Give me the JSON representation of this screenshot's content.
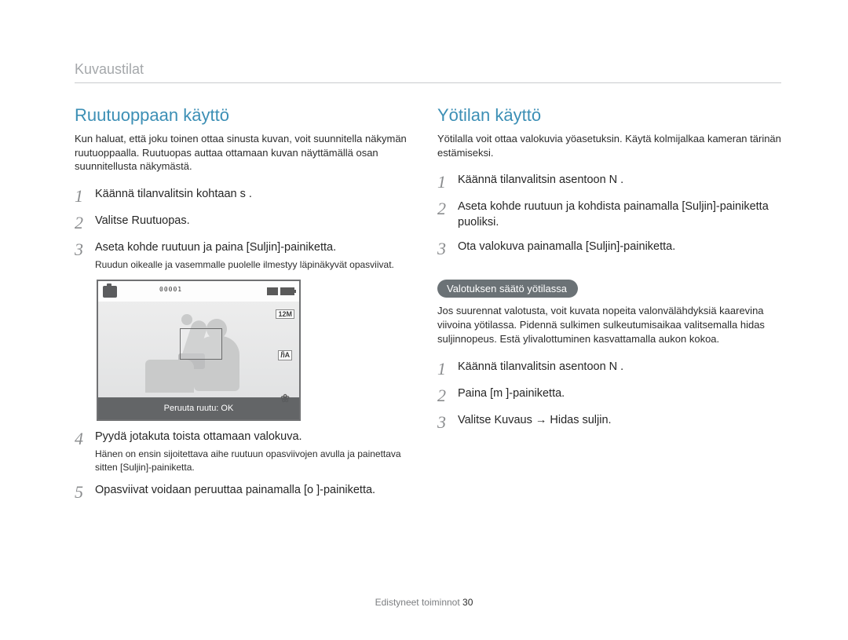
{
  "header": {
    "section": "Kuvaustilat"
  },
  "left": {
    "title": "Ruutuoppaan käyttö",
    "intro": "Kun haluat, että joku toinen ottaa sinusta kuvan, voit suunnitella näkymän ruutuoppaalla. Ruutuopas auttaa ottamaan kuvan näyttämällä osan suunnitellusta näkymästä.",
    "steps": {
      "1": "Käännä tilanvalitsin kohtaan  s     .",
      "2": "Valitse Ruutuopas.",
      "3": "Aseta kohde ruutuun ja paina [Suljin]-painiketta.",
      "3_sub": "Ruudun oikealle ja vasemmalle puolelle ilmestyy läpinäkyvät opasviivat.",
      "4": "Pyydä jotakuta toista ottamaan valokuva.",
      "4_sub": "Hänen on ensin sijoitettava aihe ruutuun opasviivojen avulla ja painettava sitten [Suljin]-painiketta.",
      "5": "Opasviivat voidaan peruuttaa painamalla [o    ]-painiketta."
    },
    "illustration": {
      "counter": "00001",
      "res_label": "12M",
      "flash_label": "ⴌA",
      "bottom_text": "Peruuta ruutu: OK"
    }
  },
  "right": {
    "title": "Yötilan käyttö",
    "intro": "Yötilalla voit ottaa valokuvia yöasetuksin. Käytä kolmijalkaa kameran tärinän estämiseksi.",
    "steps": {
      "1": "Käännä tilanvalitsin asentoon  N  .",
      "2": "Aseta kohde ruutuun ja kohdista painamalla [Suljin]-painiketta puoliksi.",
      "3": "Ota valokuva painamalla [Suljin]-painiketta."
    },
    "pill": {
      "label": "Valotuksen säätö yötilassa",
      "body": "Jos suurennat valotusta, voit kuvata nopeita valonvälähdyksiä kaarevina viivoina yötilassa. Pidennä sulkimen sulkeutumisaikaa valitsemalla hidas suljinnopeus. Estä ylivalottuminen kasvattamalla aukon kokoa."
    },
    "steps2": {
      "1": "Käännä tilanvalitsin asentoon  N  .",
      "2": "Paina [m       ]-painiketta.",
      "3": "Valitse Kuvaus → Hidas suljin."
    }
  },
  "footer": {
    "label": "Edistyneet toiminnot",
    "page": "30"
  }
}
